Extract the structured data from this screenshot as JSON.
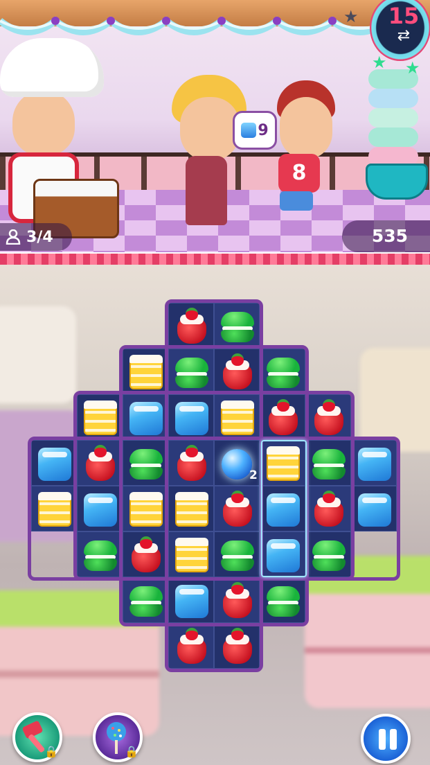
{
  "hud": {
    "moves_left": "15",
    "players": "3/4",
    "score": "535",
    "order_count": "9",
    "shirt_number": "8"
  },
  "board": {
    "rows": [
      [
        null,
        null,
        null,
        "straw",
        "macaron",
        null,
        null,
        null,
        null
      ],
      [
        null,
        null,
        "slice",
        "macaron",
        "straw",
        "macaron",
        null,
        null,
        null
      ],
      [
        null,
        "slice",
        "cube",
        "cube",
        "slice",
        "straw",
        "straw",
        null,
        null
      ],
      [
        "cube",
        "straw",
        "macaron",
        "straw",
        "special",
        "slice",
        "macaron",
        "cube",
        null
      ],
      [
        "slice",
        "cube",
        "slice",
        "slice",
        "straw",
        "cube",
        "straw",
        "cube",
        null
      ],
      [
        null,
        "macaron",
        "straw",
        "slice",
        "macaron",
        "cube",
        "macaron",
        null,
        null
      ],
      [
        null,
        null,
        "macaron",
        "cube",
        "straw",
        "macaron",
        null,
        null,
        null
      ],
      [
        null,
        null,
        null,
        "straw",
        "straw",
        null,
        null,
        null,
        null
      ]
    ],
    "special_count": "2",
    "hint_column": 5
  },
  "buttons": {
    "hammer": "hammer-booster-locked",
    "cakepop": "cakepop-booster-locked",
    "pause": "pause"
  },
  "colors": {
    "board_cell": "#2b3a7a",
    "board_frame": "#7a3fa1",
    "accent_pink": "#ff4d7d"
  }
}
